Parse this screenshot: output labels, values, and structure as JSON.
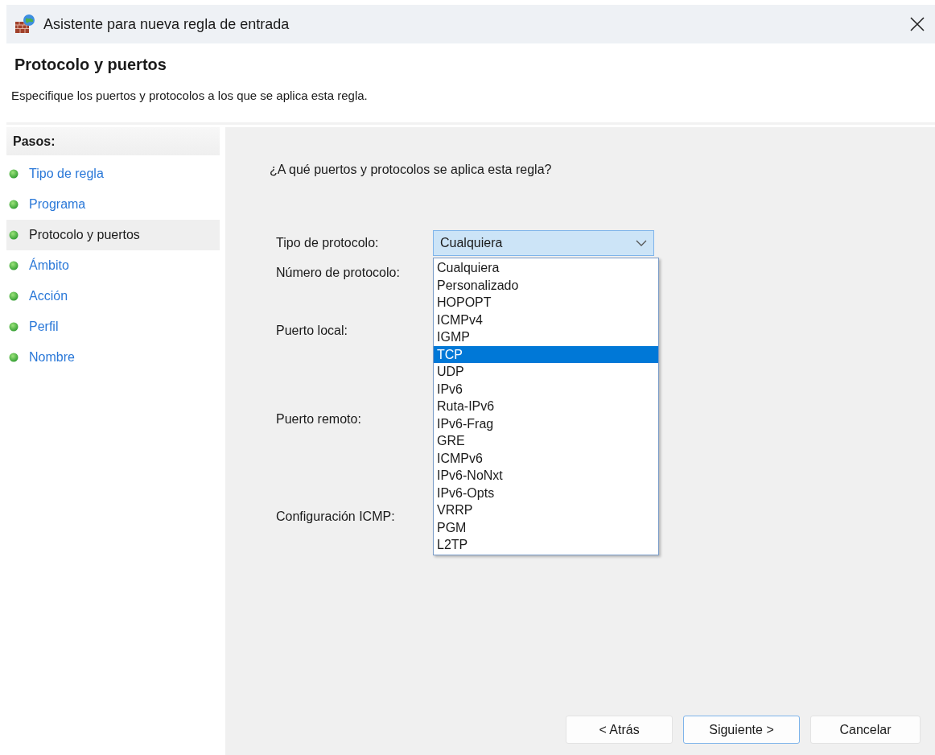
{
  "window": {
    "title": "Asistente para nueva regla de entrada"
  },
  "header": {
    "title": "Protocolo y puertos",
    "description": "Especifique los puertos y protocolos a los que se aplica esta regla."
  },
  "steps_label": "Pasos:",
  "steps": [
    {
      "label": "Tipo de regla",
      "selected": false
    },
    {
      "label": "Programa",
      "selected": false
    },
    {
      "label": "Protocolo y puertos",
      "selected": true
    },
    {
      "label": "Ámbito",
      "selected": false
    },
    {
      "label": "Acción",
      "selected": false
    },
    {
      "label": "Perfil",
      "selected": false
    },
    {
      "label": "Nombre",
      "selected": false
    }
  ],
  "question": "¿A qué puertos y protocolos se aplica esta regla?",
  "fields": [
    {
      "label": "Tipo de protocolo:"
    },
    {
      "label": "Número de protocolo:"
    },
    {
      "label": "Puerto local:"
    },
    {
      "label": "Puerto remoto:"
    },
    {
      "label": "Configuración ICMP:"
    }
  ],
  "protocol_combo": {
    "value": "Cualquiera",
    "expanded": true
  },
  "protocol_options": [
    {
      "label": "Cualquiera",
      "selected": false
    },
    {
      "label": "Personalizado",
      "selected": false
    },
    {
      "label": "HOPOPT",
      "selected": false
    },
    {
      "label": "ICMPv4",
      "selected": false
    },
    {
      "label": "IGMP",
      "selected": false
    },
    {
      "label": "TCP",
      "selected": true
    },
    {
      "label": "UDP",
      "selected": false
    },
    {
      "label": "IPv6",
      "selected": false
    },
    {
      "label": "Ruta-IPv6",
      "selected": false
    },
    {
      "label": "IPv6-Frag",
      "selected": false
    },
    {
      "label": "GRE",
      "selected": false
    },
    {
      "label": "ICMPv6",
      "selected": false
    },
    {
      "label": "IPv6-NoNxt",
      "selected": false
    },
    {
      "label": "IPv6-Opts",
      "selected": false
    },
    {
      "label": "VRRP",
      "selected": false
    },
    {
      "label": "PGM",
      "selected": false
    },
    {
      "label": "L2TP",
      "selected": false
    }
  ],
  "buttons": [
    {
      "label": "< Atrás",
      "default": false
    },
    {
      "label": "Siguiente >",
      "default": true
    },
    {
      "label": "Cancelar",
      "default": false
    }
  ]
}
